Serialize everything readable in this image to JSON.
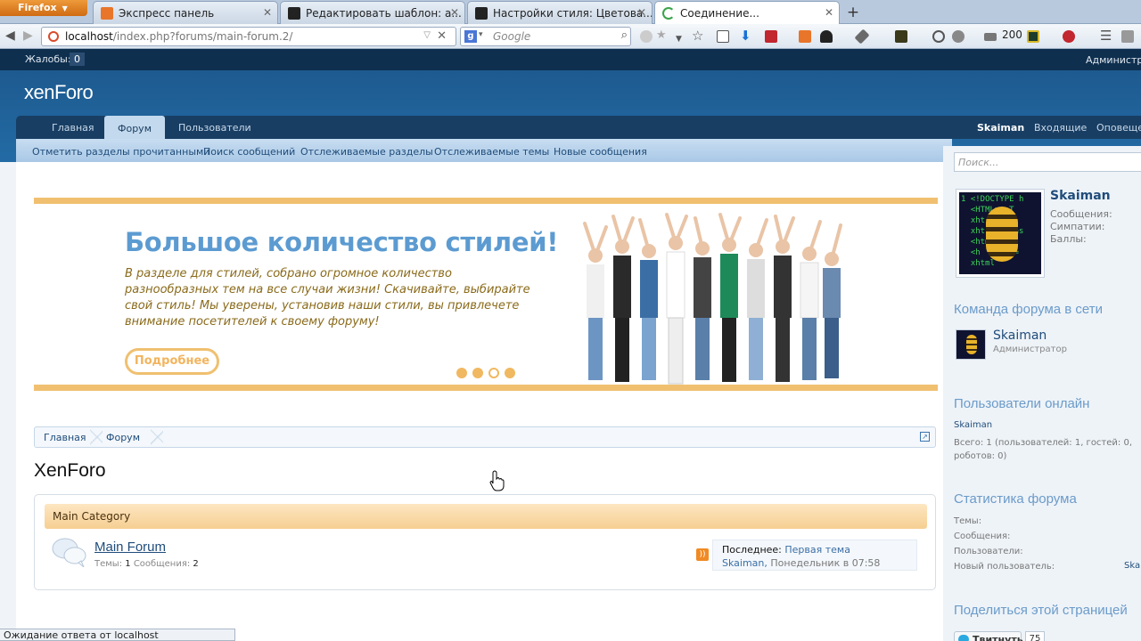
{
  "browser": {
    "menu_label": "Firefox",
    "tabs": [
      {
        "title": "Экспресс панель",
        "icon_color": "#e8752a"
      },
      {
        "title": "Редактировать шаблон: a...",
        "icon_color": "#222222"
      },
      {
        "title": "Настройки стиля: Цветова...",
        "icon_color": "#222222"
      },
      {
        "title": "Соединение...",
        "icon_color": "#3aa34a"
      }
    ],
    "url_host": "localhost",
    "url_path": "/index.php?forums/main-forum.2/",
    "search_placeholder": "Google",
    "toolbar_count": "200",
    "status_text": "Ожидание ответа от localhost"
  },
  "site": {
    "complaints_label": "Жалобы:",
    "complaints_count": "0",
    "admin_label": "Администрирование",
    "logo": "xenForo",
    "nav": {
      "home": "Главная",
      "forum": "Форум",
      "members": "Пользователи",
      "username": "Skaiman",
      "inbox": "Входящие",
      "alerts": "Оповещения"
    },
    "subnav": [
      "Отметить разделы прочитанными",
      "Поиск сообщений",
      "Отслеживаемые разделы",
      "Отслеживаемые темы",
      "Новые сообщения"
    ],
    "banner": {
      "heading": "Большое количество стилей!",
      "text": "В разделе для стилей, собрано огромное количество разнообразных тем на все случаи жизни! Скачивайте, выбирайте свой стиль! Мы уверены, установив наши стили, вы привлечете внимание посетителей к своему форуму!",
      "button": "Подробнее",
      "slides_total": 4,
      "active_slide": 3
    },
    "breadcrumb": [
      "Главная",
      "Форум"
    ],
    "page_title": "XenForo",
    "category": {
      "title": "Main Category",
      "forum": {
        "title": "Main Forum",
        "threads_label": "Темы:",
        "threads": "1",
        "posts_label": "Сообщения:",
        "posts": "2",
        "last_label": "Последнее:",
        "last_thread": "Первая тема",
        "last_user": "Skaiman,",
        "last_time": "Понедельник в 07:58"
      }
    }
  },
  "sidebar": {
    "search_placeholder": "Поиск...",
    "user": {
      "name": "Skaiman",
      "messages_label": "Сообщения:",
      "likes_label": "Симпатии:",
      "points_label": "Баллы:"
    },
    "staff_title": "Команда форума в сети",
    "staff": {
      "name": "Skaiman",
      "role": "Администратор"
    },
    "online_title": "Пользователи онлайн",
    "online_user": "Skaiman",
    "online_stats": "Всего: 1 (пользователей: 1, гостей: 0, роботов: 0)",
    "stats_title": "Статистика форума",
    "stats": {
      "threads": "Темы:",
      "messages": "Сообщения:",
      "users": "Пользователи:",
      "new_user": "Новый пользователь:",
      "new_user_value": "Skai"
    },
    "share_title": "Поделиться этой страницей",
    "tweet_label": "Твитнуть",
    "tweet_count": "75"
  }
}
